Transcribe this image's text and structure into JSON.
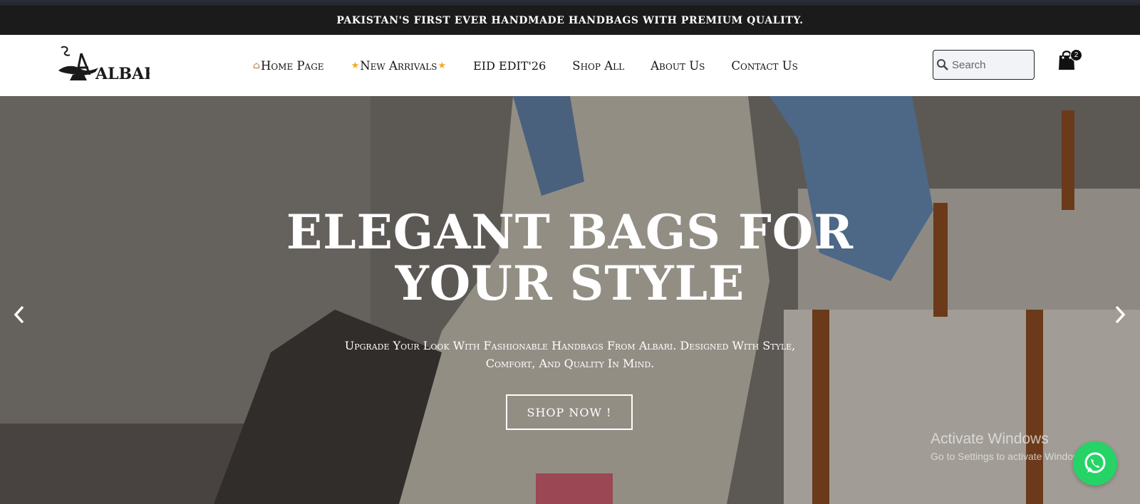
{
  "announcement": {
    "text": "PAKISTAN'S FIRST EVER HANDMADE HANDBAGS WITH PREMIUM QUALITY."
  },
  "brand": {
    "logo_text": "ALBARI",
    "logo_icon": "aladdin-lamp-icon"
  },
  "nav": {
    "items": [
      {
        "label": "Home Page",
        "icon": "house-icon"
      },
      {
        "label": "New Arrivals",
        "icon": "star-icon"
      },
      {
        "label": "EID EDIT'26"
      },
      {
        "label": "Shop All"
      },
      {
        "label": "About Us"
      },
      {
        "label": "Contact Us"
      }
    ]
  },
  "search": {
    "placeholder": "Search",
    "icon": "search-icon"
  },
  "cart": {
    "count": "2",
    "icon": "shopping-bag-icon"
  },
  "hero": {
    "title_line1": "ELEGANT BAGS FOR",
    "title_line2": "YOUR STYLE",
    "subtitle_line1": "Upgrade Your Look With Fashionable Handbags From Albari. Designed With Style,",
    "subtitle_line2": "Comfort, And Quality In Mind.",
    "cta_label": "SHOP NOW !",
    "prev_icon": "chevron-left-icon",
    "next_icon": "chevron-right-icon"
  },
  "watermark": {
    "title": "Activate Windows",
    "subtitle": "Go to Settings to activate Windows."
  },
  "whatsapp": {
    "icon": "whatsapp-icon"
  },
  "colors": {
    "announcement_bg": "#1b1b1b",
    "header_bg": "#ffffff",
    "text_dark": "#141414",
    "whatsapp_green": "#25d366",
    "star_gold": "#f3a826"
  }
}
